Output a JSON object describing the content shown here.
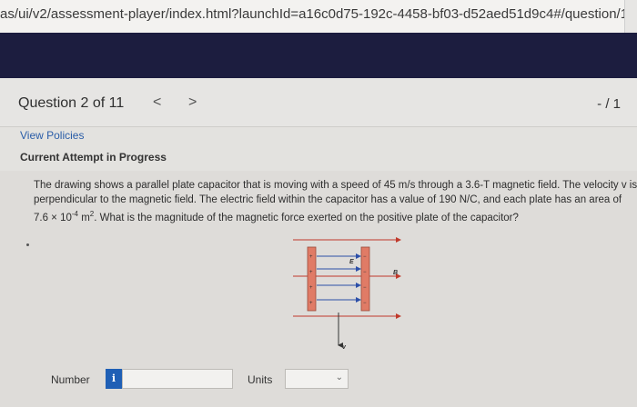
{
  "browser": {
    "url": "as/ui/v2/assessment-player/index.html?launchId=a16c0d75-192c-4458-bf03-d52aed51d9c4#/question/1"
  },
  "header": {
    "question_label": "Question 2 of 11",
    "prev_glyph": "<",
    "next_glyph": ">",
    "score": "- / 1"
  },
  "links": {
    "view_policies": "View Policies",
    "current_attempt": "Current Attempt in Progress"
  },
  "problem": {
    "line1": "The drawing shows a parallel plate capacitor that is moving with a speed of 45 m/s through a 3.6-T magnetic field. The velocity v is",
    "line2": "perpendicular to the magnetic field. The electric field within the capacitor has a value of 190 N/C, and each plate has an area of",
    "line3_pre": "7.6 × 10",
    "line3_exp": "-4",
    "line3_unit": " m",
    "line3_unit_exp": "2",
    "line3_post": ". What is the magnitude of the magnetic force exerted on the positive plate of the capacitor?"
  },
  "diagram": {
    "e_field_label": "E",
    "b_field_label": "B",
    "velocity_label": "v",
    "plus_sign": "+",
    "minus_sign": "−",
    "plate_color": "#e07b66",
    "field_line_color": "#c0392b",
    "e_arrow_color": "#2c4fa8"
  },
  "answer": {
    "number_label": "Number",
    "info_icon": "i",
    "number_value": "",
    "units_label": "Units",
    "units_value": ""
  },
  "colors": {
    "banner": "#1c1d3f",
    "link": "#2a5da8",
    "info_badge": "#1f5fb5"
  }
}
